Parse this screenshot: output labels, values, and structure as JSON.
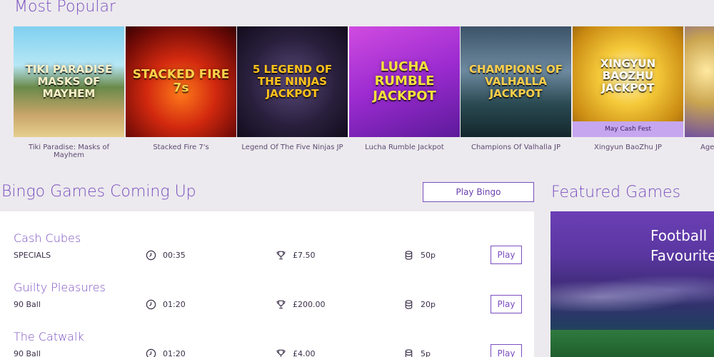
{
  "most_popular": {
    "title": "Most Popular",
    "games": [
      {
        "caption": "Tiki Paradise: Masks of Mayhem",
        "logo": "TIKI PARADISE MASKS OF MAYHEM",
        "banner": ""
      },
      {
        "caption": "Stacked Fire 7's",
        "logo": "STACKED FIRE 7s",
        "banner": ""
      },
      {
        "caption": "Legend Of The Five Ninjas JP",
        "logo": "5 LEGEND OF THE NINJAS JACKPOT",
        "banner": ""
      },
      {
        "caption": "Lucha Rumble Jackpot",
        "logo": "LUCHA RUMBLE JACKPOT",
        "banner": ""
      },
      {
        "caption": "Champions Of Valhalla JP",
        "logo": "CHAMPIONS OF VALHALLA JACKPOT",
        "banner": ""
      },
      {
        "caption": "Xingyun BaoZhu JP",
        "logo": "XINGYUN BAOZHU JACKPOT",
        "banner": "May Cash Fest"
      },
      {
        "caption": "Age",
        "logo": "",
        "banner": ""
      }
    ]
  },
  "bingo": {
    "title": "Bingo Games Coming Up",
    "play_bingo_label": "Play Bingo",
    "play_label": "Play",
    "rooms": [
      {
        "name": "Cash Cubes",
        "type": "SPECIALS",
        "time": "00:35",
        "prize": "£7.50",
        "price": "50p"
      },
      {
        "name": "Guilty Pleasures",
        "type": "90 Ball",
        "time": "01:20",
        "prize": "£200.00",
        "price": "20p"
      },
      {
        "name": "The Catwalk",
        "type": "90 Ball",
        "time": "01:20",
        "prize": "£4.00",
        "price": "5p"
      }
    ]
  },
  "featured": {
    "title": "Featured Games",
    "promo_line1": "Football",
    "promo_line2": "Favourite"
  },
  "colors": {
    "accent": "#7a4ec0",
    "background": "#eceaee",
    "banner": "#c6a6ef"
  },
  "icons": {
    "time": "clock-icon",
    "prize": "trophy-icon",
    "price": "coins-icon"
  }
}
